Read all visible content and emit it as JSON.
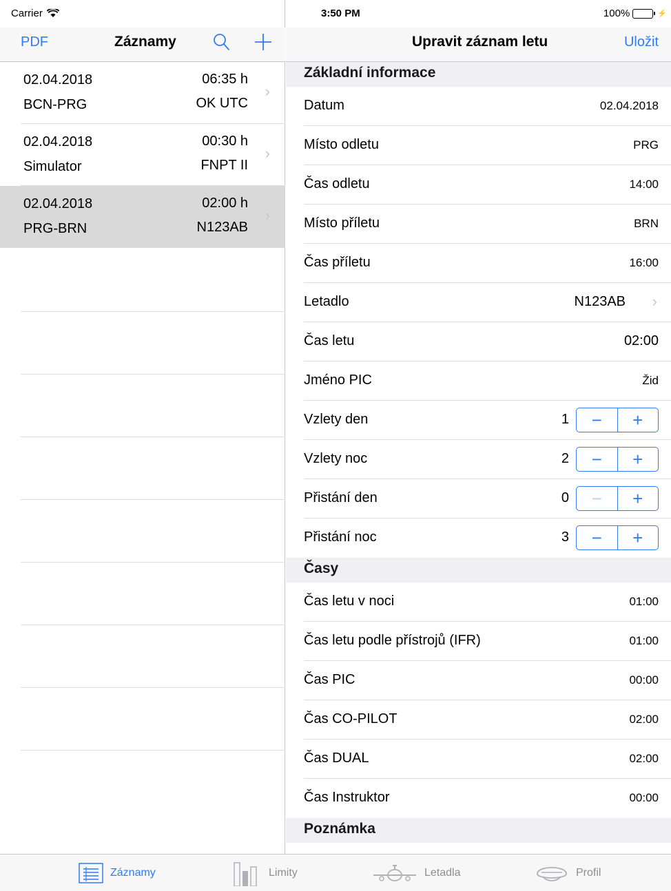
{
  "status": {
    "carrier": "Carrier",
    "time": "3:50 PM",
    "battery": "100%"
  },
  "master": {
    "left_button": "PDF",
    "title": "Záznamy",
    "rows": [
      {
        "date": "02.04.2018",
        "route": "BCN-PRG",
        "duration": "06:35 h",
        "extra": "OK UTC"
      },
      {
        "date": "02.04.2018",
        "route": "Simulator",
        "duration": "00:30 h",
        "extra": "FNPT II"
      },
      {
        "date": "02.04.2018",
        "route": "PRG-BRN",
        "duration": "02:00 h",
        "extra": "N123AB"
      }
    ]
  },
  "detail": {
    "title": "Upravit záznam letu",
    "save": "Uložit",
    "sections": [
      {
        "header": "Základní informace",
        "fields": [
          {
            "label": "Datum",
            "value": "02.04.2018"
          },
          {
            "label": "Místo odletu",
            "value": "PRG"
          },
          {
            "label": "Čas odletu",
            "value": "14:00"
          },
          {
            "label": "Místo příletu",
            "value": "BRN"
          },
          {
            "label": "Čas příletu",
            "value": "16:00"
          },
          {
            "label": "Letadlo",
            "value": "N123AB"
          },
          {
            "label": "Čas letu",
            "value": "02:00"
          },
          {
            "label": "Jméno PIC",
            "value": "Žid"
          },
          {
            "label": "Vzlety den",
            "value": "1"
          },
          {
            "label": "Vzlety noc",
            "value": "2"
          },
          {
            "label": "Přistání den",
            "value": "0"
          },
          {
            "label": "Přistání noc",
            "value": "3"
          }
        ]
      },
      {
        "header": "Časy",
        "fields": [
          {
            "label": "Čas letu v noci",
            "value": "01:00"
          },
          {
            "label": "Čas letu podle přístrojů (IFR)",
            "value": "01:00"
          },
          {
            "label": "Čas PIC",
            "value": "00:00"
          },
          {
            "label": "Čas CO-PILOT",
            "value": "02:00"
          },
          {
            "label": "Čas DUAL",
            "value": "02:00"
          },
          {
            "label": "Čas Instruktor",
            "value": "00:00"
          }
        ]
      },
      {
        "header": "Poznámka"
      }
    ]
  },
  "tabs": [
    {
      "label": "Záznamy",
      "icon": "list-icon",
      "active": true
    },
    {
      "label": "Limity",
      "icon": "bar-chart-icon",
      "active": false
    },
    {
      "label": "Letadla",
      "icon": "airplane-icon",
      "active": false
    },
    {
      "label": "Profil",
      "icon": "pilot-cap-icon",
      "active": false
    }
  ],
  "colors": {
    "accent": "#2f7cf6",
    "selected_row": "#d9d9d9",
    "section_bg": "#efeff4"
  }
}
